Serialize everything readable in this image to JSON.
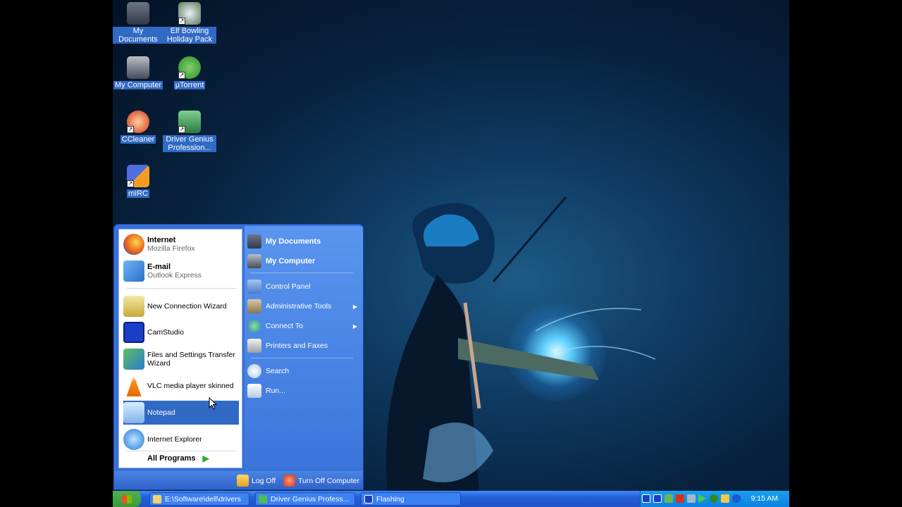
{
  "desktop": {
    "icons": [
      {
        "label": "My Documents"
      },
      {
        "label": "Elf Bowling Holiday Pack"
      },
      {
        "label": "My Computer"
      },
      {
        "label": "µTorrent"
      },
      {
        "label": "CCleaner"
      },
      {
        "label": "Driver Genius Profession..."
      },
      {
        "label": "mIRC"
      }
    ]
  },
  "start_menu": {
    "pinned": [
      {
        "title": "Internet",
        "subtitle": "Mozilla Firefox"
      },
      {
        "title": "E-mail",
        "subtitle": "Outlook Express"
      }
    ],
    "recent": [
      {
        "label": "New Connection Wizard"
      },
      {
        "label": "CamStudio"
      },
      {
        "label": "Files and Settings Transfer Wizard"
      },
      {
        "label": "VLC media player skinned"
      },
      {
        "label": "Notepad"
      },
      {
        "label": "Internet Explorer"
      }
    ],
    "all_programs": "All Programs",
    "right": {
      "my_documents": "My Documents",
      "my_computer": "My Computer",
      "control_panel": "Control Panel",
      "admin_tools": "Administrative Tools",
      "connect_to": "Connect To",
      "printers": "Printers and Faxes",
      "search": "Search",
      "run": "Run..."
    },
    "log_off": "Log Off",
    "turn_off": "Turn Off Computer"
  },
  "taskbar": {
    "buttons": [
      {
        "label": "E:\\Software\\dell\\drivers"
      },
      {
        "label": "Driver Genius Profess..."
      },
      {
        "label": "Flashing"
      }
    ],
    "clock": "9:15 AM"
  },
  "colors": {
    "accent": "#316ac5",
    "taskbar": "#245edb",
    "tray": "#0c80e0",
    "start_button": "#3a9a3a"
  }
}
